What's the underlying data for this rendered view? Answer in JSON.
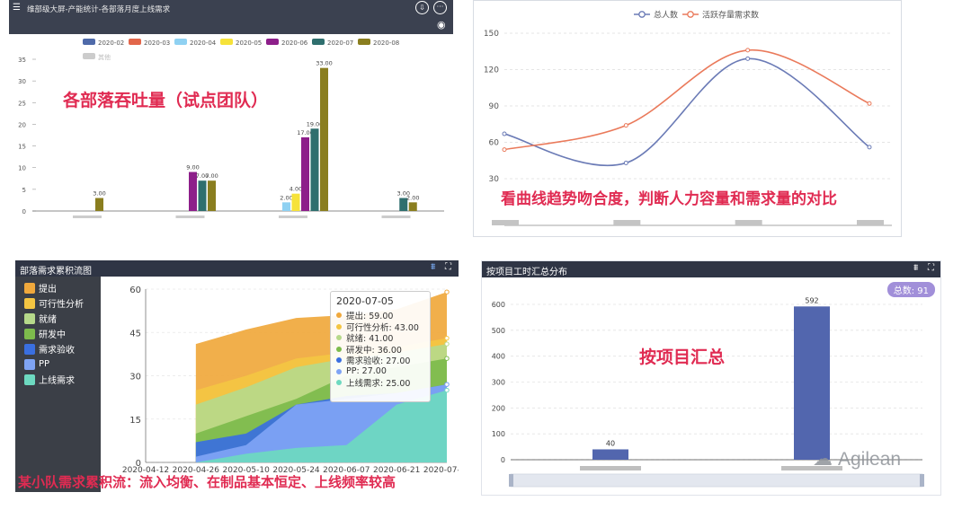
{
  "panel_top_left": {
    "header_title": "维部级大屏-产能统计-各部落月度上线需求",
    "overlay_text": "各部落吞吐量（试点团队）"
  },
  "panel_top_right": {
    "overlay_text": "看曲线趋势吻合度，判断人力容量和需求量的对比"
  },
  "panel_bottom_left": {
    "header_title": "部落需求累积流图",
    "overlay_text": "某小队需求累积流：流入均衡、在制品基本恒定、上线频率较高",
    "tooltip": {
      "date": "2020-07-05",
      "rows": [
        {
          "label": "提出: 59.00",
          "color": "#f0a83c"
        },
        {
          "label": "可行性分析: 43.00",
          "color": "#f4c542"
        },
        {
          "label": "就绪: 41.00",
          "color": "#b6d98a"
        },
        {
          "label": "研发中: 36.00",
          "color": "#7dbb4c"
        },
        {
          "label": "需求验收: 27.00",
          "color": "#3a6fe0"
        },
        {
          "label": "PP: 27.00",
          "color": "#7fa4f5"
        },
        {
          "label": "上线需求: 25.00",
          "color": "#6dd9c0"
        }
      ]
    }
  },
  "panel_bottom_right": {
    "header_title": "按项目工时汇总分布",
    "total_badge": "总数: 91",
    "overlay_text": "按项目汇总",
    "watermark": "Agilean"
  },
  "chart_data": [
    {
      "type": "bar",
      "categories": [
        "",
        "",
        "",
        ""
      ],
      "series": [
        {
          "name": "2020-02",
          "color": "#4f6aa9",
          "values": [
            null,
            null,
            null,
            null
          ]
        },
        {
          "name": "2020-03",
          "color": "#e2664a",
          "values": [
            null,
            null,
            null,
            null
          ]
        },
        {
          "name": "2020-04",
          "color": "#8fd1f2",
          "values": [
            null,
            null,
            2,
            null
          ]
        },
        {
          "name": "2020-05",
          "color": "#f6e23a",
          "values": [
            null,
            null,
            4,
            null
          ]
        },
        {
          "name": "2020-06",
          "color": "#8d1f8a",
          "values": [
            null,
            9,
            17,
            null
          ]
        },
        {
          "name": "2020-07",
          "color": "#2f6f6e",
          "values": [
            null,
            7,
            19,
            3
          ]
        },
        {
          "name": "2020-08",
          "color": "#8a7e1f",
          "values": [
            3,
            7,
            33,
            2
          ]
        }
      ],
      "extra_legend": "其他",
      "data_labels": [
        {
          "cat": 0,
          "series": 6,
          "text": "3.00"
        },
        {
          "cat": 1,
          "series": 4,
          "text": "9.00"
        },
        {
          "cat": 1,
          "series": 5,
          "text": "7.00"
        },
        {
          "cat": 1,
          "series": 6,
          "text": "7.00"
        },
        {
          "cat": 2,
          "series": 2,
          "text": "2.00"
        },
        {
          "cat": 2,
          "series": 3,
          "text": "4.00"
        },
        {
          "cat": 2,
          "series": 4,
          "text": "17.00"
        },
        {
          "cat": 2,
          "series": 5,
          "text": "19.00"
        },
        {
          "cat": 2,
          "series": 6,
          "text": "33.00"
        },
        {
          "cat": 3,
          "series": 5,
          "text": "3.00"
        },
        {
          "cat": 3,
          "series": 6,
          "text": "2.00"
        }
      ],
      "yticks": [
        0,
        5,
        10,
        15,
        20,
        25,
        30,
        35
      ],
      "ylim": [
        0,
        35
      ]
    },
    {
      "type": "line",
      "x_count": 4,
      "series": [
        {
          "name": "总人数",
          "color": "#6b7bb6",
          "values": [
            67,
            43,
            129,
            56
          ]
        },
        {
          "name": "活跃存量需求数",
          "color": "#ea7a5b",
          "values": [
            54,
            74,
            136,
            92
          ]
        }
      ],
      "yticks": [
        30,
        60,
        90,
        120,
        150
      ],
      "ylim": [
        30,
        150
      ]
    },
    {
      "type": "area",
      "x": [
        "2020-04-12",
        "2020-04-26",
        "2020-05-10",
        "2020-05-24",
        "2020-06-07",
        "2020-06-21",
        "2020-07-05"
      ],
      "series": [
        {
          "name": "提出",
          "color": "#f0a83c",
          "values": [
            null,
            41,
            46,
            50,
            51,
            53,
            59
          ]
        },
        {
          "name": "可行性分析",
          "color": "#f4c542",
          "values": [
            null,
            25,
            30,
            36,
            38,
            40,
            43
          ]
        },
        {
          "name": "就绪",
          "color": "#b6d98a",
          "values": [
            null,
            20,
            26,
            33,
            36,
            38,
            41
          ]
        },
        {
          "name": "研发中",
          "color": "#7dbb4c",
          "values": [
            null,
            10,
            16,
            22,
            30,
            33,
            36
          ]
        },
        {
          "name": "需求验收",
          "color": "#3a6fe0",
          "values": [
            null,
            7,
            10,
            20,
            23,
            24,
            27
          ]
        },
        {
          "name": "PP",
          "color": "#7fa4f5",
          "values": [
            null,
            2,
            6,
            20,
            22,
            24,
            27
          ]
        },
        {
          "name": "上线需求",
          "color": "#6dd9c0",
          "values": [
            null,
            0,
            3,
            5,
            6,
            20,
            25
          ]
        }
      ],
      "yticks": [
        0,
        15,
        30,
        45,
        60
      ],
      "ylim": [
        0,
        60
      ]
    },
    {
      "type": "bar",
      "categories": [
        "",
        ""
      ],
      "values": [
        40,
        592
      ],
      "color": "#5266ae",
      "data_labels": [
        "40",
        "592"
      ],
      "yticks": [
        0,
        100,
        200,
        300,
        400,
        500,
        600
      ],
      "ylim": [
        0,
        600
      ]
    }
  ]
}
